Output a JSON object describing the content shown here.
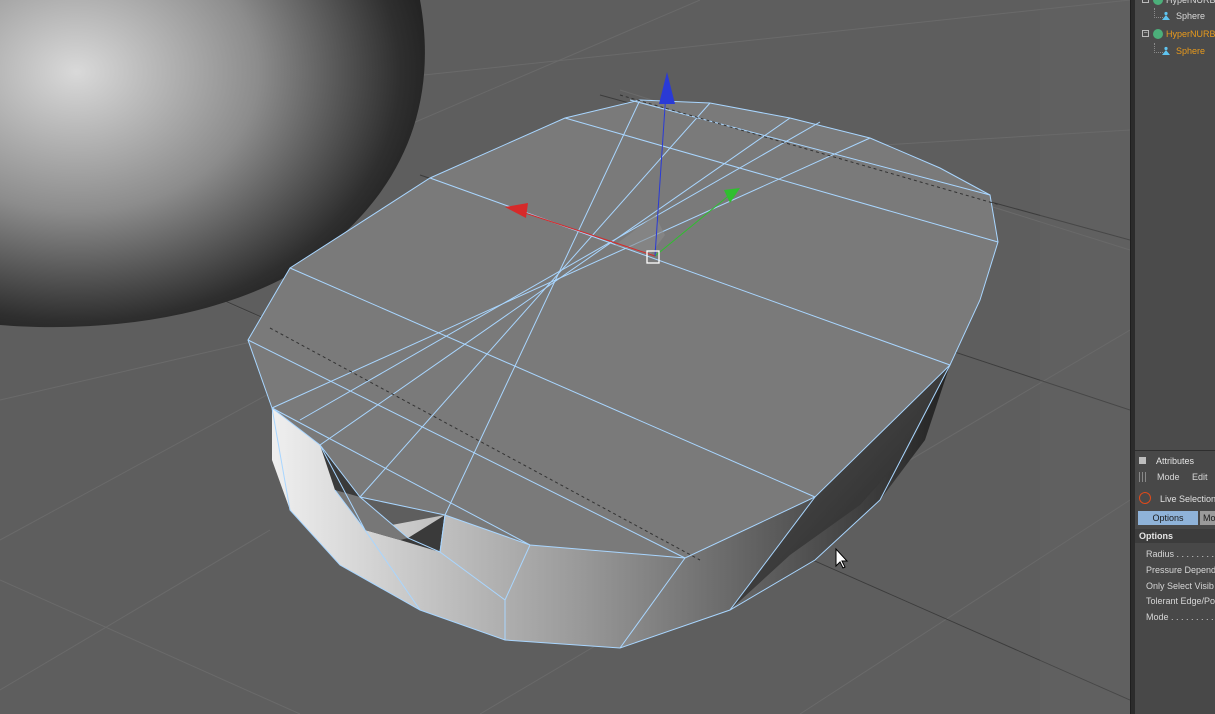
{
  "object_manager": {
    "items": [
      {
        "label": "HyperNURBS",
        "color": "#d8d8d8"
      },
      {
        "label": "Sphere",
        "color": "#d8d8d8"
      },
      {
        "label": "HyperNURBS",
        "color": "#e89a1c"
      },
      {
        "label": "Sphere",
        "color": "#e89a1c"
      }
    ]
  },
  "attributes": {
    "title": "Attributes",
    "menu": [
      "Mode",
      "Edit"
    ],
    "tool_name": "Live Selection",
    "tabs": [
      "Options",
      "Mo"
    ],
    "section": "Options",
    "options": [
      {
        "label": "Radius . . . . . . . ."
      },
      {
        "label": "Pressure Depend"
      },
      {
        "label": "Only Select Visib"
      },
      {
        "label": "Tolerant Edge/Po"
      },
      {
        "label": "Mode . . . . . . . . ."
      }
    ]
  },
  "colors": {
    "viewport_bg": "#5e5e5e",
    "wire": "#a9d6ff",
    "axis_x": "#d62a2a",
    "axis_y": "#2fbf2f",
    "axis_z": "#2a3ad6",
    "selected_text": "#e89a1c",
    "active_tab": "#8fb3d9"
  }
}
